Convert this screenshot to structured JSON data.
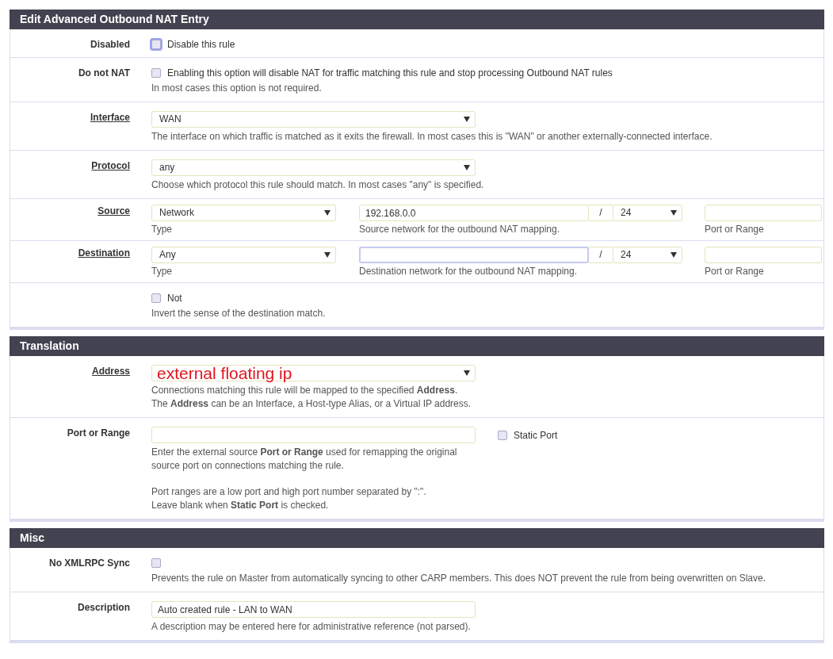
{
  "sections": [
    {
      "title": "Edit Advanced Outbound NAT Entry",
      "rows": [
        {
          "kind": "checkbox",
          "label": "Disabled",
          "link": false,
          "checkbox": {
            "label": "Disable this rule",
            "checked": false,
            "focused": true
          },
          "help": []
        },
        {
          "kind": "checkbox",
          "label": "Do not NAT",
          "link": false,
          "checkbox": {
            "label": "Enabling this option will disable NAT for traffic matching this rule and stop processing Outbound NAT rules",
            "checked": false,
            "focused": false
          },
          "help": [
            [
              "In most cases this option is not required."
            ]
          ]
        },
        {
          "kind": "select",
          "label": "Interface",
          "link": true,
          "select": {
            "value": "WAN",
            "annotated": false
          },
          "help": [
            [
              "The interface on which traffic is matched as it exits the firewall. In most cases this is \"WAN\" or another externally-connected interface."
            ]
          ]
        },
        {
          "kind": "select",
          "label": "Protocol",
          "link": true,
          "select": {
            "value": "any",
            "annotated": false
          },
          "help": [
            [
              "Choose which protocol this rule should match. In most cases \"any\" is specified."
            ]
          ]
        },
        {
          "kind": "network",
          "label": "Source",
          "link": true,
          "type": {
            "value": "Network",
            "caption": "Type"
          },
          "address": {
            "value": "192.168.0.0",
            "focused": false,
            "separator": "/",
            "mask": "24",
            "caption": "Source network for the outbound NAT mapping."
          },
          "port": {
            "caption": "Port or Range"
          }
        },
        {
          "kind": "network",
          "label": "Destination",
          "link": true,
          "type": {
            "value": "Any",
            "caption": "Type"
          },
          "address": {
            "focused": true,
            "separator": "/",
            "mask": "24",
            "caption": "Destination network for the outbound NAT mapping."
          },
          "port": {
            "caption": "Port or Range"
          }
        },
        {
          "kind": "checkbox",
          "checkbox": {
            "label": "Not",
            "checked": false,
            "focused": false
          },
          "help": [
            [
              "Invert the sense of the destination match."
            ]
          ]
        }
      ]
    },
    {
      "title": "Translation",
      "rows": [
        {
          "kind": "select",
          "label": "Address",
          "link": true,
          "select": {
            "value": "external floating ip",
            "annotated": true
          },
          "help": [
            [
              "Connections matching this rule will be mapped to the specified **Address**.",
              "The **Address** can be an Interface, a Host-type Alias, or a Virtual IP address."
            ]
          ]
        },
        {
          "kind": "port",
          "label": "Port or Range",
          "link": false,
          "checkbox": {
            "label": "Static Port",
            "checked": false,
            "focused": false
          },
          "help": [
            [
              "Enter the external source **Port or Range** used for remapping the original",
              "source port on connections matching the rule."
            ],
            [
              "Port ranges are a low port and high port number separated by \":\".",
              "Leave blank when **Static Port** is checked."
            ]
          ]
        }
      ]
    },
    {
      "title": "Misc",
      "rows": [
        {
          "kind": "checkbox",
          "label": "No XMLRPC Sync",
          "link": false,
          "checkbox": {
            "checked": false,
            "focused": false
          },
          "help": [
            [
              "Prevents the rule on Master from automatically syncing to other CARP members. This does NOT prevent the rule from being overwritten on Slave."
            ]
          ]
        },
        {
          "kind": "text",
          "label": "Description",
          "link": false,
          "input": {
            "value": "Auto created rule - LAN to WAN"
          },
          "help": [
            [
              "A description may be entered here for administrative reference (not parsed)."
            ]
          ]
        }
      ]
    }
  ]
}
